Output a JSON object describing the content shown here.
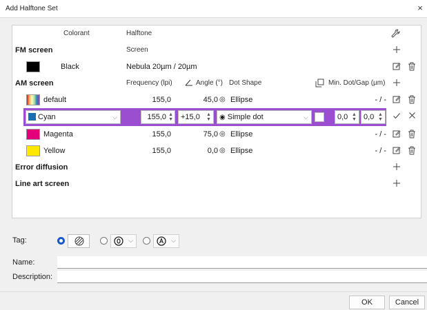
{
  "window": {
    "title": "Add Halftone Set",
    "close_glyph": "×"
  },
  "header": {
    "colorant": "Colorant",
    "halftone": "Halftone"
  },
  "fm": {
    "label": "FM screen",
    "sub_header": "Screen",
    "black": {
      "name": "Black",
      "value": "Nebula 20µm / 20µm",
      "color": "#000000"
    }
  },
  "am": {
    "label": "AM screen",
    "col_freq": "Frequency (lpi)",
    "col_angle": "Angle (°)",
    "col_dot": "Dot Shape",
    "col_min": "Min. Dot/Gap (µm)",
    "rows": [
      {
        "name": "default",
        "freq": "155,0",
        "angle": "45,0",
        "dot": "Ellipse",
        "min": "- / -",
        "swatch": "rainbow"
      },
      {
        "name": "Magenta",
        "freq": "155,0",
        "angle": "75,0",
        "dot": "Ellipse",
        "min": "- / -",
        "color": "#e3007a"
      },
      {
        "name": "Yellow",
        "freq": "155,0",
        "angle": "0,0",
        "dot": "Ellipse",
        "min": "- / -",
        "color": "#ffe800"
      }
    ],
    "edit": {
      "colorant": "Cyan",
      "color": "#1b6fb0",
      "freq": "155,0",
      "angle": "+15,0",
      "dot": "Simple dot",
      "min_dot": "0,0",
      "min_gap": "0,0"
    }
  },
  "error_diffusion": {
    "label": "Error diffusion"
  },
  "line_art": {
    "label": "Line art screen"
  },
  "tag": {
    "label": "Tag:"
  },
  "form": {
    "name_label": "Name:",
    "description_label": "Description:"
  },
  "buttons": {
    "ok": "OK",
    "cancel": "Cancel"
  },
  "accent": "#9b4fd0"
}
